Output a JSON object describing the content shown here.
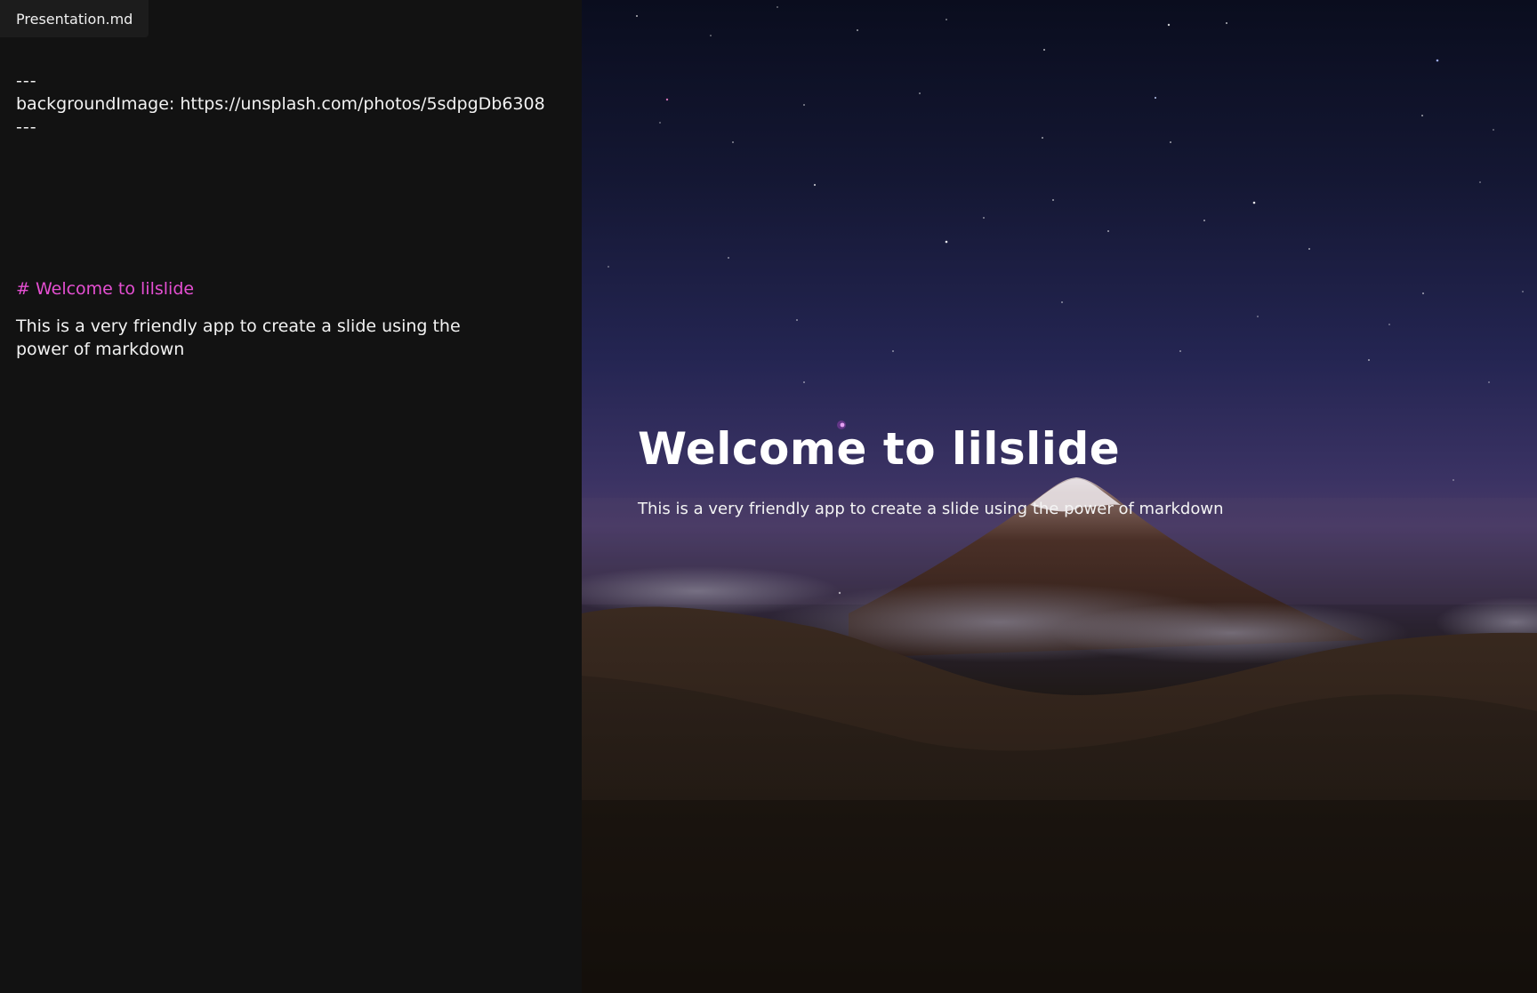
{
  "editor": {
    "tab_label": "Presentation.md",
    "frontmatter_open": "---",
    "frontmatter_line": "backgroundImage: https://unsplash.com/photos/5sdpgDb6308",
    "frontmatter_close": "---",
    "heading_line": "# Welcome to lilslide",
    "paragraph_line": "This is a very friendly app to create a slide using the power of markdown",
    "heading_color": "#e54fd2"
  },
  "preview": {
    "title": "Welcome to lilslide",
    "text": "This is a very friendly app to create a slide using the power of markdown"
  }
}
